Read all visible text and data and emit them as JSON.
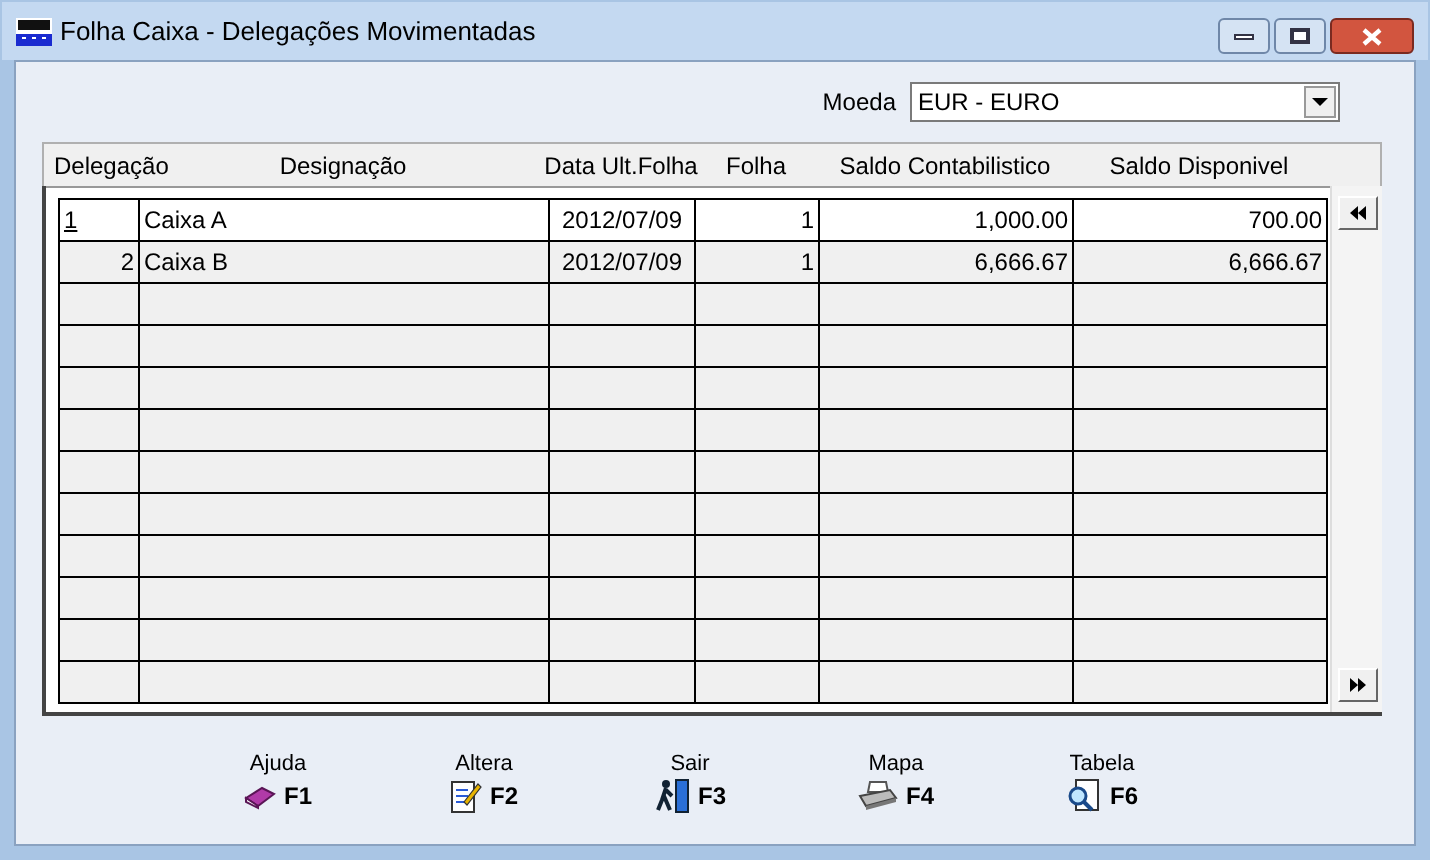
{
  "window": {
    "title": "Folha Caixa - Delegações Movimentadas"
  },
  "currency": {
    "label": "Moeda",
    "value": "EUR - EURO"
  },
  "table": {
    "columns": [
      "Delegação",
      "Designação",
      "Data Ult.Folha",
      "Folha",
      "Saldo Contabilistico",
      "Saldo Disponivel"
    ],
    "rows": [
      {
        "selected": true,
        "cells": [
          "1",
          "Caixa A",
          "2012/07/09",
          "1",
          "1,000.00",
          "700.00"
        ]
      },
      {
        "selected": false,
        "cells": [
          "2",
          "Caixa B",
          "2012/07/09",
          "1",
          "6,666.67",
          "6,666.67"
        ]
      }
    ]
  },
  "actions": [
    {
      "kind": "help",
      "label": "Ajuda",
      "key": "F1"
    },
    {
      "kind": "edit",
      "label": "Altera",
      "key": "F2"
    },
    {
      "kind": "exit",
      "label": "Sair",
      "key": "F3"
    },
    {
      "kind": "print",
      "label": "Mapa",
      "key": "F4"
    },
    {
      "kind": "table",
      "label": "Tabela",
      "key": "F6"
    }
  ]
}
